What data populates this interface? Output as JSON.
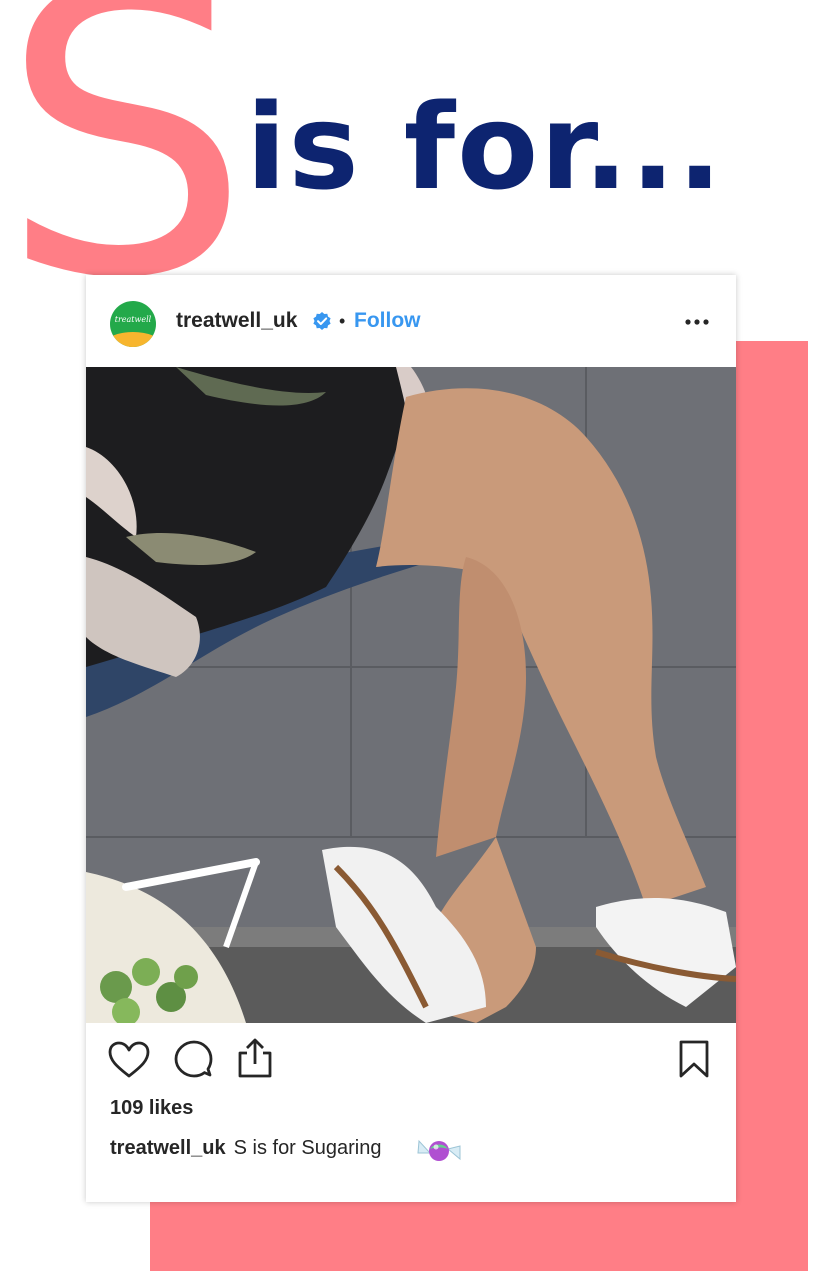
{
  "headline": {
    "big_letter": "S",
    "text": "is for..."
  },
  "post": {
    "username": "treatwell_uk",
    "separator": "•",
    "follow_label": "Follow",
    "avatar_text": "treatwell",
    "likes": "109 likes",
    "caption_user": "treatwell_uk",
    "caption_text": "S is for Sugaring",
    "icons": [
      "verified-badge-icon",
      "more-options-icon",
      "heart-icon",
      "comment-icon",
      "share-icon",
      "bookmark-icon",
      "candy-emoji"
    ]
  },
  "colors": {
    "accent_pink": "#ff7e86",
    "headline_navy": "#0d2470",
    "follow_blue": "#3897f0",
    "text_dark": "#262626"
  }
}
